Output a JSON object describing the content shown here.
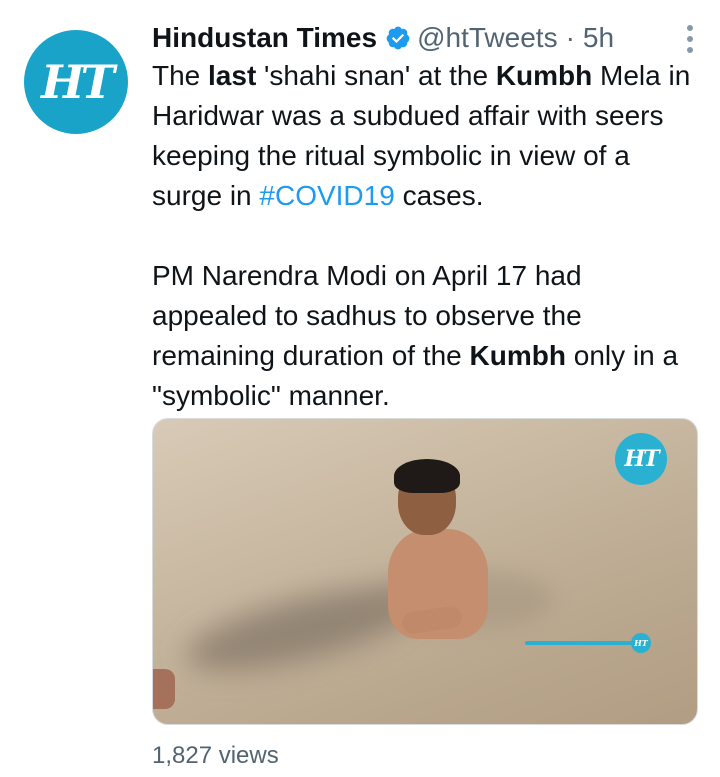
{
  "tweet": {
    "author_name": "Hindustan Times",
    "handle": "@htTweets",
    "separator": "·",
    "time": "5h",
    "avatar_text": "HT",
    "paragraph1": {
      "t1": "The ",
      "b1": "last",
      "t2": " 'shahi snan' at the ",
      "b2": "Kumbh",
      "t3": " Mela in Haridwar was a subdued affair with seers keeping the ritual symbolic in view of a surge in ",
      "hashtag": "#COVID19",
      "t4": " cases."
    },
    "paragraph2": {
      "t1": "PM Narendra Modi on April 17 had appealed to sadhus to observe the remaining duration of the ",
      "b1": "Kumbh",
      "t2": " only in a \"symbolic\" manner."
    },
    "views": "1,827 views"
  },
  "media": {
    "watermark": "HT",
    "progress_marker": "HT"
  },
  "colors": {
    "brand": "#1aa3c8",
    "link": "#1d9bf0",
    "secondary_text": "#536471",
    "verified": "#1d9bf0"
  },
  "icons": {
    "verified": "verified-badge-icon",
    "more": "more-options-icon"
  }
}
